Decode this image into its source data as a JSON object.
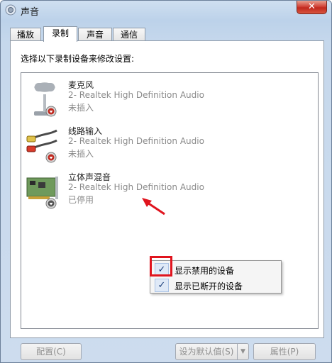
{
  "window": {
    "title": "声音",
    "close_icon": "close-icon",
    "speaker_icon": "speaker-icon"
  },
  "tabs": [
    {
      "label": "播放",
      "active": false
    },
    {
      "label": "录制",
      "active": true
    },
    {
      "label": "声音",
      "active": false
    },
    {
      "label": "通信",
      "active": false
    }
  ],
  "instruction": "选择以下录制设备来修改设置:",
  "devices": [
    {
      "name": "麦克风",
      "driver": "2- Realtek High Definition Audio",
      "status": "未插入",
      "icon": "microphone-icon"
    },
    {
      "name": "线路输入",
      "driver": "2- Realtek High Definition Audio",
      "status": "未插入",
      "icon": "line-in-icon"
    },
    {
      "name": "立体声混音",
      "driver": "2- Realtek High Definition Audio",
      "status": "已停用",
      "icon": "sound-card-icon"
    }
  ],
  "context_menu": {
    "items": [
      {
        "label": "显示禁用的设备",
        "checked": true
      },
      {
        "label": "显示已断开的设备",
        "checked": true
      }
    ],
    "check_glyph": "✓"
  },
  "buttons": {
    "configure": "配置(C)",
    "set_default": "设为默认值(S)",
    "properties": "属性(P)"
  },
  "colors": {
    "highlight": "#e0141e",
    "disabled_text": "#8a8a8a"
  }
}
